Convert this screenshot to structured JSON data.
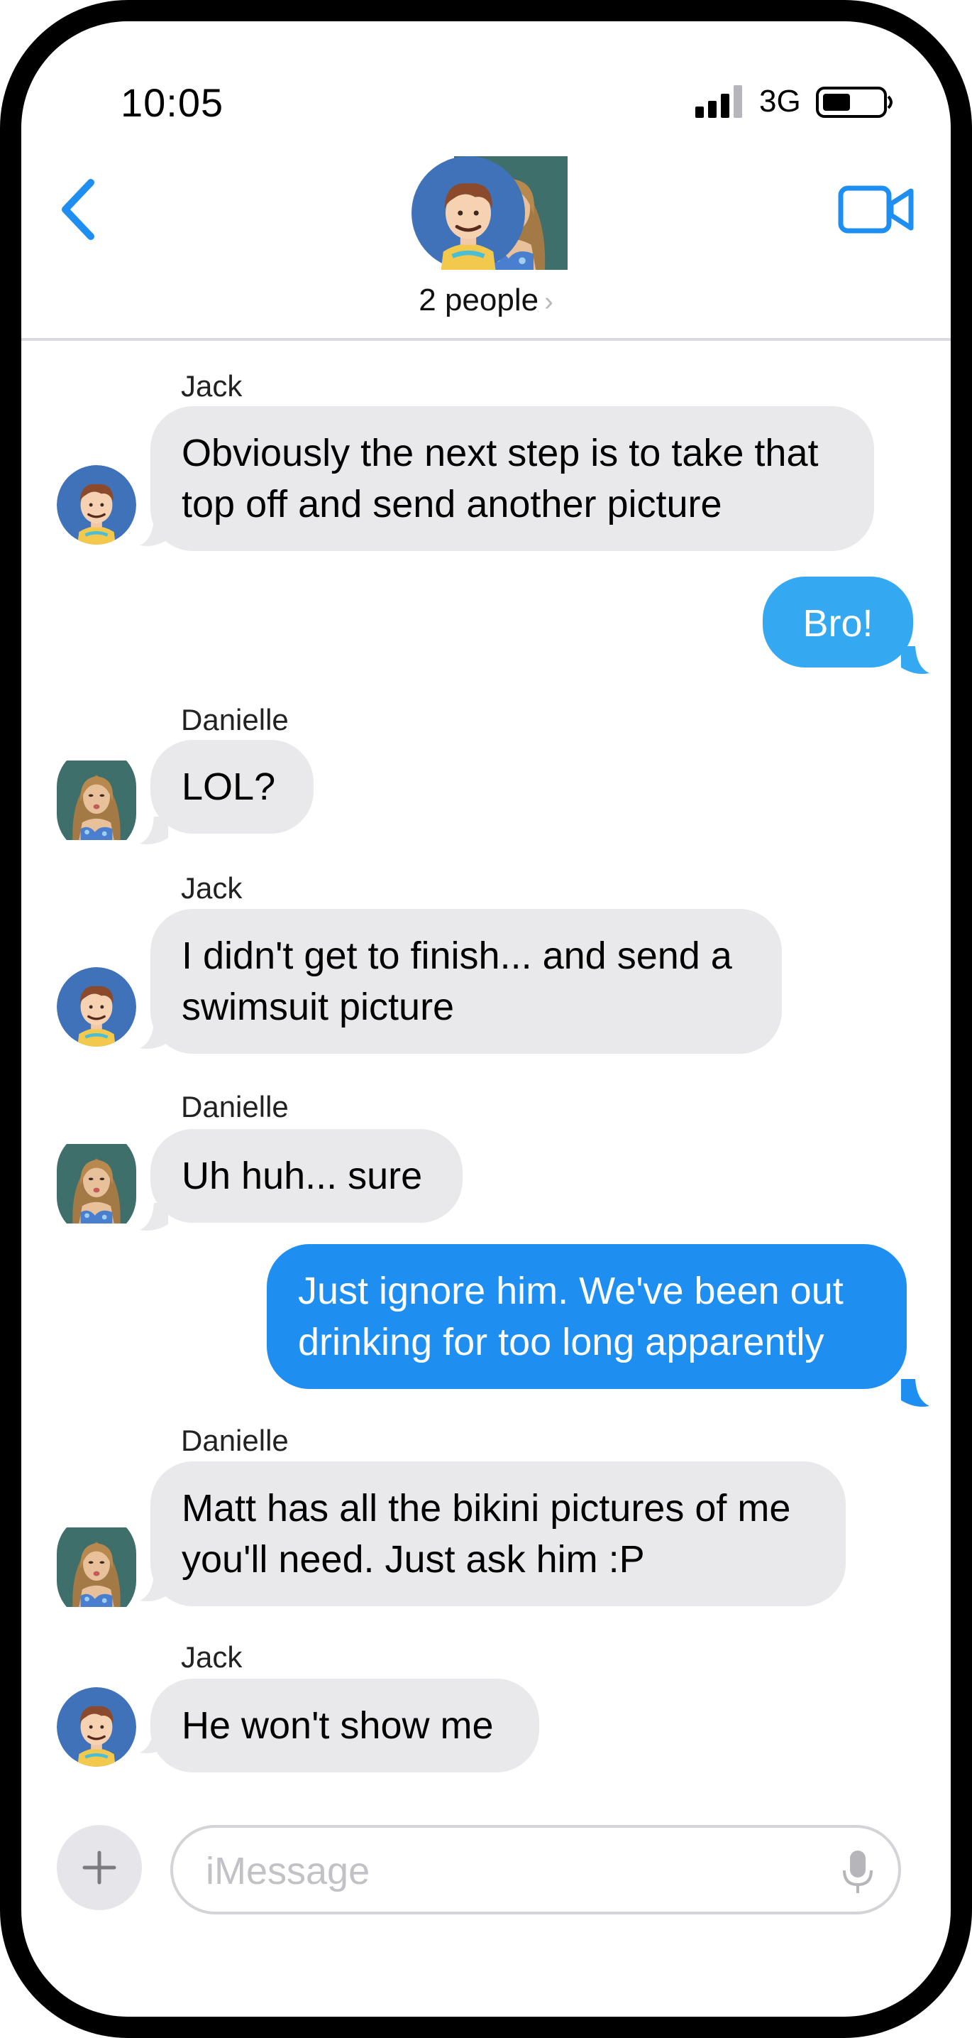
{
  "status_bar": {
    "time": "10:05",
    "network": "3G"
  },
  "header": {
    "group_label": "2 people",
    "chevron": "›"
  },
  "messages": [
    {
      "direction": "incoming",
      "sender": "Jack",
      "text": "Obviously the next step is to take that top off and send another picture"
    },
    {
      "direction": "outgoing",
      "text": "Bro!"
    },
    {
      "direction": "incoming",
      "sender": "Danielle",
      "text": "LOL?"
    },
    {
      "direction": "incoming",
      "sender": "Jack",
      "text": "I didn't get to finish... and send a swimsuit picture"
    },
    {
      "direction": "incoming",
      "sender": "Danielle",
      "text": "Uh huh... sure"
    },
    {
      "direction": "outgoing",
      "text": "Just ignore him.  We've been out drinking for too long apparently"
    },
    {
      "direction": "incoming",
      "sender": "Danielle",
      "text": "Matt has all the bikini pictures of me you'll need.  Just ask him :P"
    },
    {
      "direction": "incoming",
      "sender": "Jack",
      "text": "He won't show me"
    }
  ],
  "composer": {
    "placeholder": "iMessage",
    "value": ""
  },
  "colors": {
    "accent": "#1e8ff0",
    "outgoing_bubble": "#34a8f0",
    "incoming_bubble": "#e9e9eb"
  },
  "icons": [
    "back-chevron-icon",
    "video-camera-icon",
    "plus-icon",
    "microphone-icon",
    "signal-icon",
    "battery-icon"
  ]
}
